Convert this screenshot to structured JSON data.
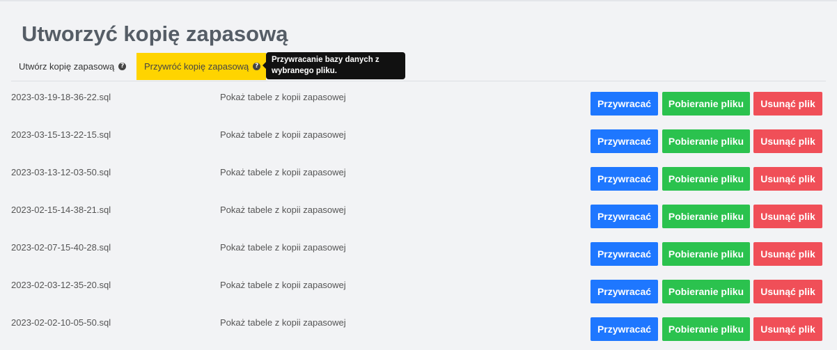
{
  "page": {
    "title": "Utworzyć kopię zapasową"
  },
  "tabs": [
    {
      "label": "Utwórz kopię zapasową",
      "active": false,
      "icon": "question-circle-icon"
    },
    {
      "label": "Przywróć kopię zapasową",
      "active": true,
      "icon": "question-circle-icon"
    }
  ],
  "tooltip": {
    "line1": "Przywracanie bazy danych z",
    "line2": "wybranego pliku."
  },
  "colors": {
    "active_tab": "#ffd400",
    "restore_button": "#1e77ff",
    "download_button": "#2bc24e",
    "delete_button": "#f04f58"
  },
  "backups": [
    {
      "file": "2023-03-19-18-36-22.sql",
      "show_tables": "Pokaż tabele z kopii zapasowej",
      "restore": "Przywracać",
      "download": "Pobieranie pliku",
      "delete": "Usunąć plik"
    },
    {
      "file": "2023-03-15-13-22-15.sql",
      "show_tables": "Pokaż tabele z kopii zapasowej",
      "restore": "Przywracać",
      "download": "Pobieranie pliku",
      "delete": "Usunąć plik"
    },
    {
      "file": "2023-03-13-12-03-50.sql",
      "show_tables": "Pokaż tabele z kopii zapasowej",
      "restore": "Przywracać",
      "download": "Pobieranie pliku",
      "delete": "Usunąć plik"
    },
    {
      "file": "2023-02-15-14-38-21.sql",
      "show_tables": "Pokaż tabele z kopii zapasowej",
      "restore": "Przywracać",
      "download": "Pobieranie pliku",
      "delete": "Usunąć plik"
    },
    {
      "file": "2023-02-07-15-40-28.sql",
      "show_tables": "Pokaż tabele z kopii zapasowej",
      "restore": "Przywracać",
      "download": "Pobieranie pliku",
      "delete": "Usunąć plik"
    },
    {
      "file": "2023-02-03-12-35-20.sql",
      "show_tables": "Pokaż tabele z kopii zapasowej",
      "restore": "Przywracać",
      "download": "Pobieranie pliku",
      "delete": "Usunąć plik"
    },
    {
      "file": "2023-02-02-10-05-50.sql",
      "show_tables": "Pokaż tabele z kopii zapasowej",
      "restore": "Przywracać",
      "download": "Pobieranie pliku",
      "delete": "Usunąć plik"
    }
  ]
}
